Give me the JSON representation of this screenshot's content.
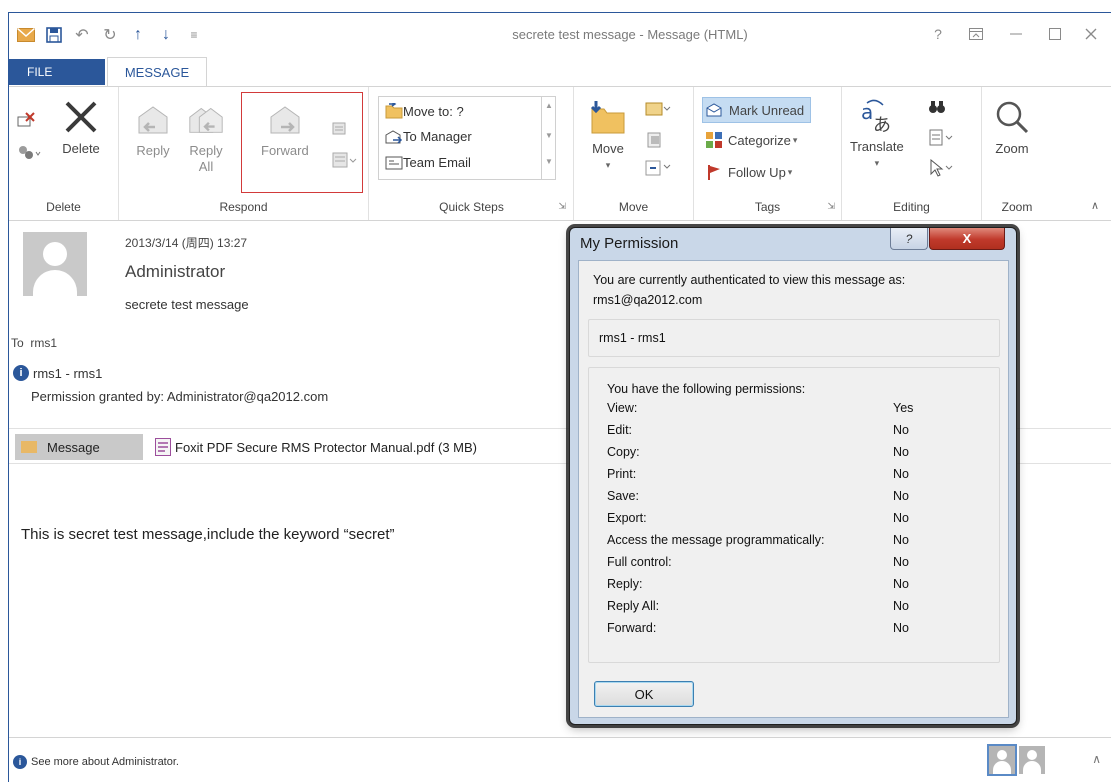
{
  "window": {
    "title": "secrete test message - Message (HTML)",
    "help_label": "?",
    "qat_more": "≡"
  },
  "tabs": {
    "file": "FILE",
    "message": "MESSAGE"
  },
  "ribbon": {
    "delete_group": {
      "label": "Delete",
      "delete_button": "Delete"
    },
    "respond_group": {
      "label": "Respond",
      "reply": "Reply",
      "reply_all_1": "Reply",
      "reply_all_2": "All",
      "forward": "Forward"
    },
    "quick_steps_group": {
      "label": "Quick Steps",
      "items": [
        "Move to: ?",
        "To Manager",
        "Team Email"
      ]
    },
    "move_group": {
      "label": "Move",
      "move_button": "Move"
    },
    "tags_group": {
      "label": "Tags",
      "mark_unread": "Mark Unread",
      "categorize": "Categorize",
      "follow_up": "Follow Up"
    },
    "editing_group": {
      "label": "Editing",
      "translate": "Translate"
    },
    "zoom_group": {
      "label": "Zoom",
      "zoom_button": "Zoom"
    }
  },
  "message": {
    "date": "2013/3/14 (周四) 13:27",
    "from": "Administrator",
    "subject": "secrete test message",
    "to_label": "To",
    "to": "rms1",
    "permission_user": "rms1 - rms1",
    "permission_granted": "Permission granted by: Administrator@qa2012.com",
    "attachment_message_tab": "Message",
    "attachment_file": "Foxit PDF Secure RMS Protector Manual.pdf (3 MB)",
    "body": "This is secret test message,include the keyword “secret”"
  },
  "statusbar": {
    "see_more": "See more about Administrator."
  },
  "dialog": {
    "title": "My Permission",
    "help_glyph": "?",
    "close_glyph": "X",
    "auth_line1": "You are currently authenticated to view this message as:",
    "auth_line2": "rms1@qa2012.com",
    "user": "rms1 - rms1",
    "permissions_header": "You have the following permissions:",
    "permissions": [
      {
        "name": "View:",
        "value": "Yes"
      },
      {
        "name": "Edit:",
        "value": "No"
      },
      {
        "name": "Copy:",
        "value": "No"
      },
      {
        "name": "Print:",
        "value": "No"
      },
      {
        "name": "Save:",
        "value": "No"
      },
      {
        "name": "Export:",
        "value": "No"
      },
      {
        "name": "Access the message programmatically:",
        "value": "No"
      },
      {
        "name": "Full control:",
        "value": "No"
      },
      {
        "name": "Reply:",
        "value": "No"
      },
      {
        "name": "Reply All:",
        "value": "No"
      },
      {
        "name": "Forward:",
        "value": "No"
      }
    ],
    "ok_button": "OK"
  },
  "colors": {
    "accent": "#2b579a",
    "highlight_border": "#d23a3a",
    "dialog_frame": "#c9d7e8",
    "close_button": "#c0392b"
  },
  "icons": {
    "qat": [
      "envelope-icon",
      "save-icon",
      "undo-icon",
      "redo-icon",
      "up-arrow-icon",
      "down-arrow-icon",
      "customize-icon"
    ],
    "window_controls": [
      "help-icon",
      "restore-ribbon-icon",
      "minimize-icon",
      "maximize-icon",
      "close-icon"
    ]
  }
}
